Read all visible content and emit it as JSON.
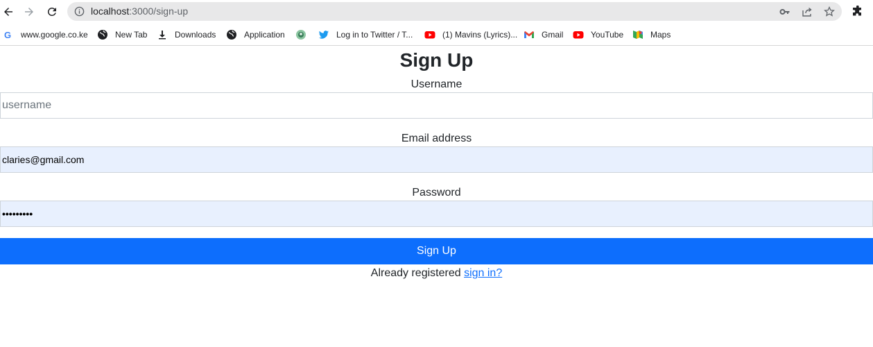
{
  "browser": {
    "url_host": "localhost",
    "url_path": ":3000/sign-up",
    "bookmarks": [
      {
        "label": "www.google.co.ke",
        "icon": "google-icon"
      },
      {
        "label": "New Tab",
        "icon": "globe-icon"
      },
      {
        "label": "Downloads",
        "icon": "download-icon"
      },
      {
        "label": "Application",
        "icon": "globe-icon"
      },
      {
        "label": "",
        "icon": "app-logo-icon"
      },
      {
        "label": "Log in to Twitter / T...",
        "icon": "twitter-icon"
      },
      {
        "label": "(1) Mavins (Lyrics)...",
        "icon": "youtube-icon"
      },
      {
        "label": "Gmail",
        "icon": "gmail-icon"
      },
      {
        "label": "YouTube",
        "icon": "youtube-icon"
      },
      {
        "label": "Maps",
        "icon": "maps-icon"
      }
    ]
  },
  "form": {
    "title": "Sign Up",
    "username_label": "Username",
    "username_placeholder": "username",
    "email_label": "Email address",
    "email_value": "claries@gmail.com",
    "password_label": "Password",
    "password_value": "•••••••••",
    "submit_label": "Sign Up",
    "footer_text": "Already registered",
    "footer_link": "sign in?"
  },
  "colors": {
    "primary": "#0d6efd",
    "autofill_bg": "#e8f0fe",
    "omnibox_bg": "#e8e8e9"
  }
}
